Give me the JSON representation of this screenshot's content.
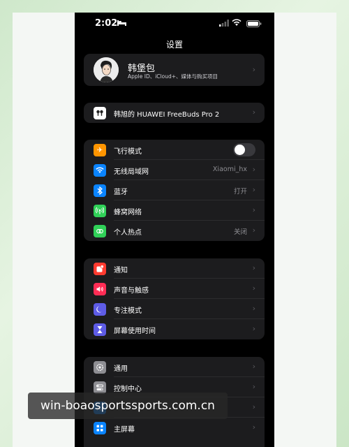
{
  "status_bar": {
    "time": "2:02"
  },
  "nav": {
    "title": "设置"
  },
  "profile": {
    "name": "韩堡包",
    "subtitle": "Apple ID、iCloud+、媒体与购买项目"
  },
  "device": {
    "label": "韩旭的 HUAWEI FreeBuds Pro 2"
  },
  "connectivity": [
    {
      "label": "飞行模式",
      "value": "",
      "icon": "airplane-icon",
      "color": "#ff9500",
      "toggle": true
    },
    {
      "label": "无线局域网",
      "value": "Xiaomi_hx",
      "icon": "wifi-icon",
      "color": "#0a84ff"
    },
    {
      "label": "蓝牙",
      "value": "打开",
      "icon": "bluetooth-icon",
      "color": "#0a84ff"
    },
    {
      "label": "蜂窝网络",
      "value": "",
      "icon": "cellular-icon",
      "color": "#30d158"
    },
    {
      "label": "个人热点",
      "value": "关闭",
      "icon": "hotspot-icon",
      "color": "#30d158"
    }
  ],
  "notifications": [
    {
      "label": "通知",
      "icon": "notification-icon",
      "color": "#ff3b30"
    },
    {
      "label": "声音与触感",
      "icon": "sound-icon",
      "color": "#ff2d55"
    },
    {
      "label": "专注模式",
      "icon": "moon-icon",
      "color": "#5e5ce6"
    },
    {
      "label": "屏幕使用时间",
      "icon": "hourglass-icon",
      "color": "#5e5ce6"
    }
  ],
  "general": [
    {
      "label": "通用",
      "icon": "gear-icon",
      "color": "#8e8e93"
    },
    {
      "label": "控制中心",
      "icon": "control-center-icon",
      "color": "#8e8e93"
    },
    {
      "label": "",
      "icon": "display-icon",
      "color": "#0a84ff"
    },
    {
      "label": "主屏幕",
      "icon": "home-screen-icon",
      "color": "#0a84ff"
    }
  ],
  "watermark": {
    "text": "win-boaosportssports.com.cn"
  }
}
